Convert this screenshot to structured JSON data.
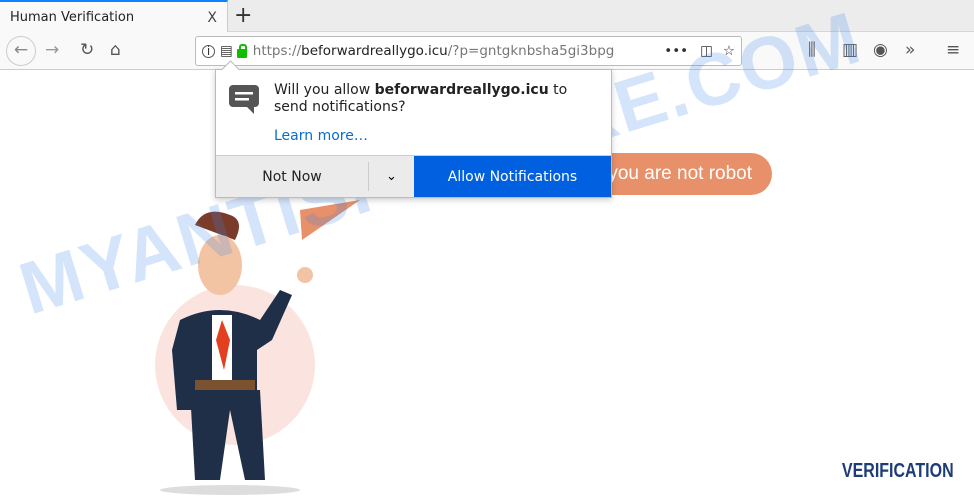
{
  "tab": {
    "title": "Human Verification",
    "close": "X",
    "new_tab": "+"
  },
  "url": {
    "scheme": "https://",
    "domain": "beforwardreallygo.icu",
    "path": "/?p=gntgknbsha5gi3bpg"
  },
  "popup": {
    "msg_prefix": "Will you allow ",
    "domain": "beforwardreallygo.icu",
    "msg_suffix": " to send notifications?",
    "learn_more": "Learn more…",
    "not_now": "Not Now",
    "allow": "Allow Notifications"
  },
  "page": {
    "bubble": "you are not robot",
    "verification": "VERIFICATION",
    "watermark": "MYANTISPYWARE.COM"
  },
  "colors": {
    "allow": "#0060df",
    "bubble": "#e89069",
    "verification": "#1d3c78"
  }
}
